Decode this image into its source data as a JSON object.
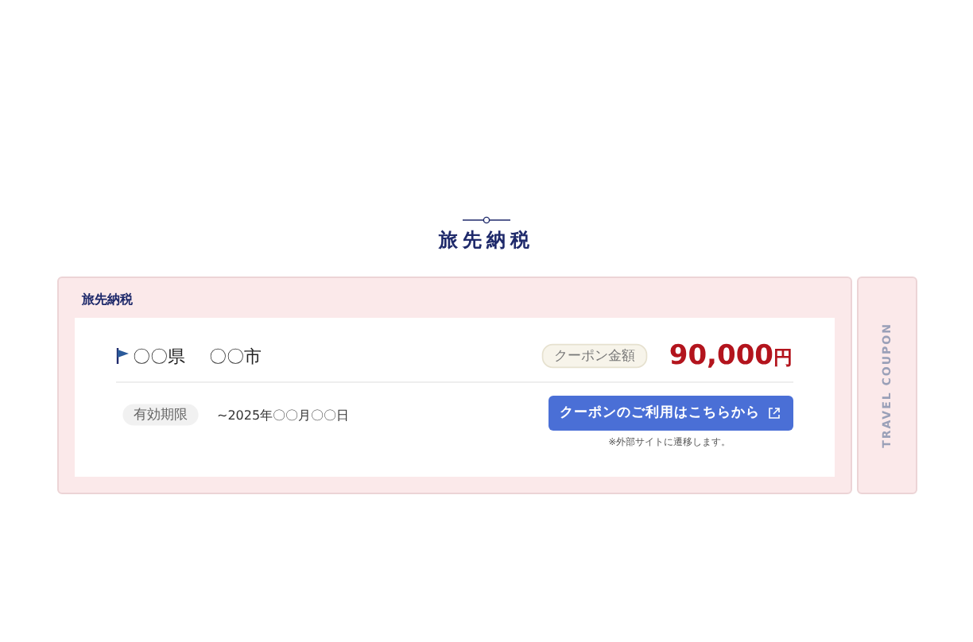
{
  "heading": "旅先納税",
  "coupon": {
    "label": "旅先納税",
    "location": {
      "prefecture": "〇〇県",
      "city": "〇〇市"
    },
    "amount_label": "クーポン金額",
    "amount": "90,000",
    "currency": "円",
    "validity_label": "有効期限",
    "validity": "~2025年〇〇月〇〇日",
    "button": "クーポンのご利用はこちらから",
    "note": "※外部サイトに遷移します。",
    "stub": "TRAVEL COUPON"
  }
}
